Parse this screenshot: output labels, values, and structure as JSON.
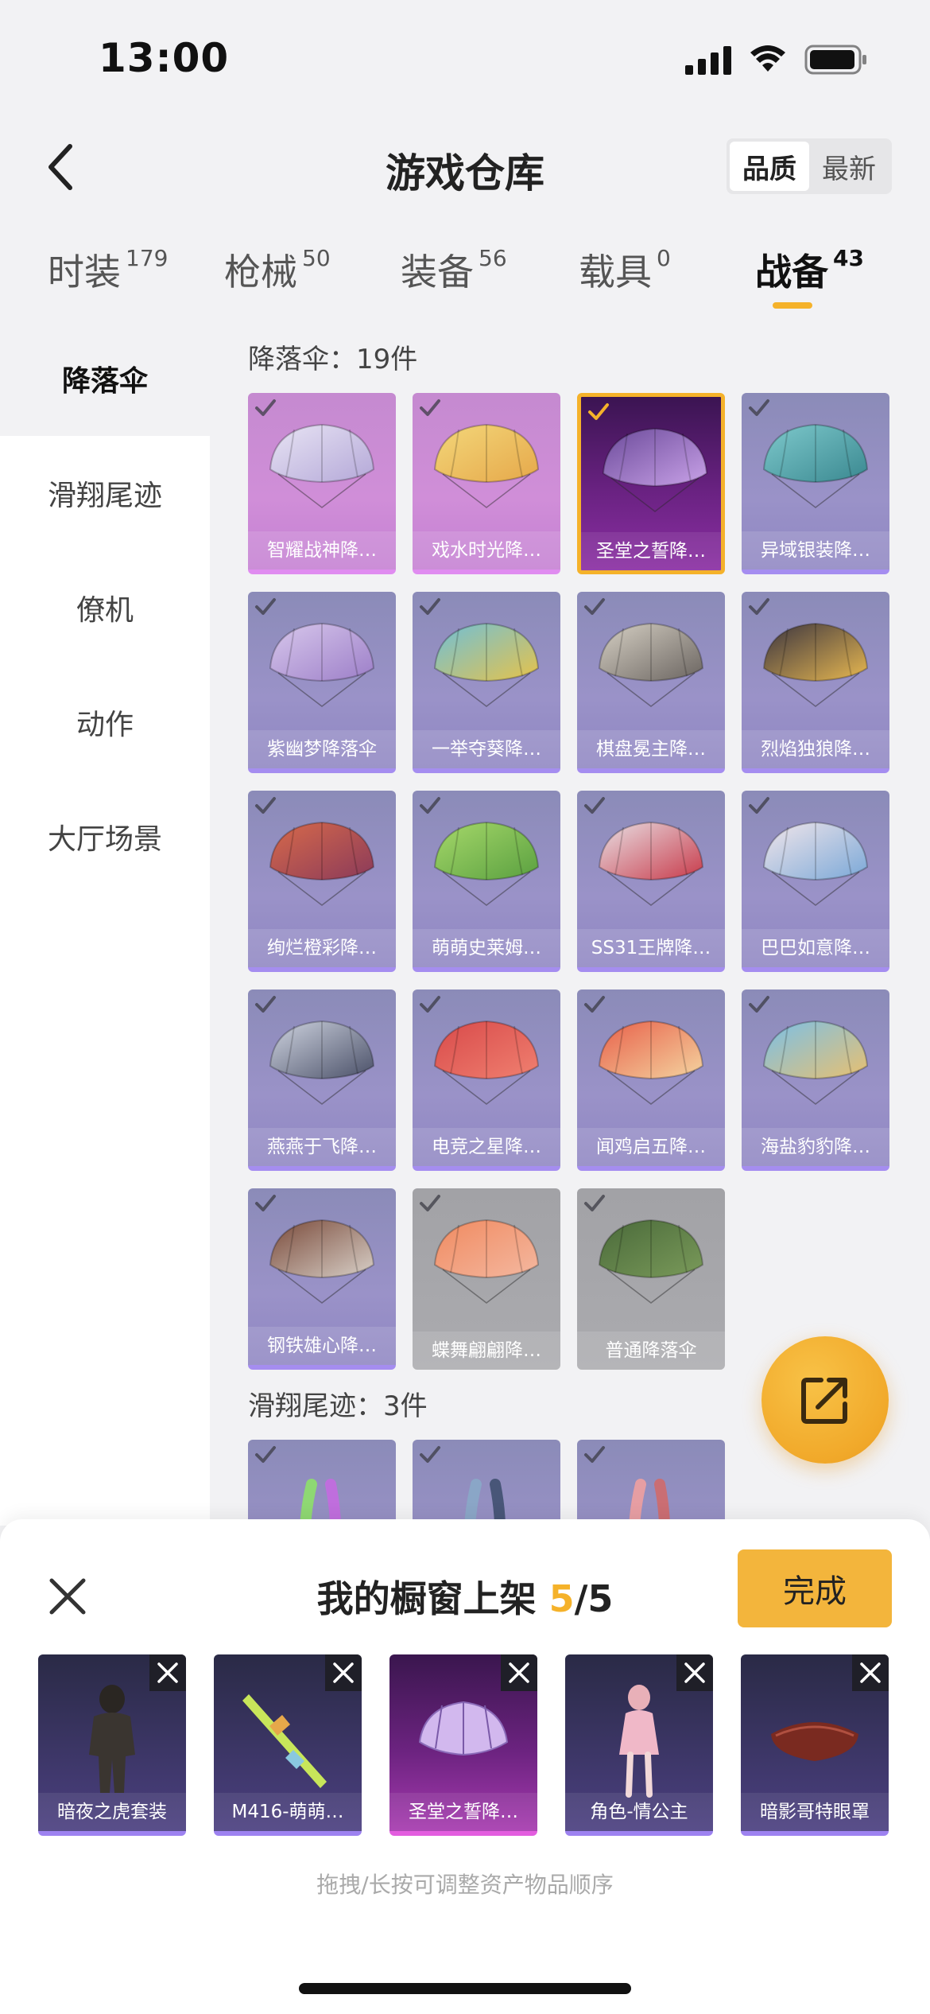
{
  "status_bar": {
    "time": "13:00"
  },
  "nav": {
    "title": "游戏仓库",
    "sort_options": [
      "品质",
      "最新"
    ],
    "active_sort": "品质"
  },
  "category_tabs": [
    {
      "label": "时装",
      "count": "179"
    },
    {
      "label": "枪械",
      "count": "50"
    },
    {
      "label": "装备",
      "count": "56"
    },
    {
      "label": "载具",
      "count": "0"
    },
    {
      "label": "战备",
      "count": "43",
      "active": true
    }
  ],
  "sidebar": {
    "items": [
      {
        "label": "降落伞",
        "active": true
      },
      {
        "label": "滑翔尾迹"
      },
      {
        "label": "僚机"
      },
      {
        "label": "动作"
      },
      {
        "label": "大厅场景"
      }
    ]
  },
  "sections": [
    {
      "title": "降落伞：19件",
      "items": [
        {
          "name": "智耀战神降…",
          "quality": "pink"
        },
        {
          "name": "戏水时光降…",
          "quality": "pink"
        },
        {
          "name": "圣堂之誓降…",
          "quality": "selected"
        },
        {
          "name": "异域银装降…",
          "quality": "purple"
        },
        {
          "name": "紫幽梦降落伞",
          "quality": "purple"
        },
        {
          "name": "一举夺葵降…",
          "quality": "purple"
        },
        {
          "name": "棋盘冕主降…",
          "quality": "purple"
        },
        {
          "name": "烈焰独狼降…",
          "quality": "purple"
        },
        {
          "name": "绚烂橙彩降…",
          "quality": "purple"
        },
        {
          "name": "萌萌史莱姆…",
          "quality": "purple"
        },
        {
          "name": "SS31王牌降…",
          "quality": "purple"
        },
        {
          "name": "巴巴如意降…",
          "quality": "purple"
        },
        {
          "name": "燕燕于飞降…",
          "quality": "purple"
        },
        {
          "name": "电竞之星降…",
          "quality": "purple"
        },
        {
          "name": "闻鸡启五降…",
          "quality": "purple"
        },
        {
          "name": "海盐豹豹降…",
          "quality": "purple"
        },
        {
          "name": "钢铁雄心降…",
          "quality": "purple"
        },
        {
          "name": "蝶舞翩翩降…",
          "quality": "grey"
        },
        {
          "name": "普通降落伞",
          "quality": "grey"
        }
      ]
    },
    {
      "title": "滑翔尾迹：3件",
      "items": [
        {
          "name": "",
          "quality": "purple"
        },
        {
          "name": "",
          "quality": "purple"
        },
        {
          "name": "",
          "quality": "purple"
        }
      ]
    }
  ],
  "shelf": {
    "title_prefix": "我的橱窗上架",
    "current": "5",
    "total": "/5",
    "done_label": "完成",
    "hint": "拖拽/长按可调整资产物品顺序",
    "items": [
      {
        "name": "暗夜之虎套装",
        "style": "purple"
      },
      {
        "name": "M416-萌萌…",
        "style": "purple"
      },
      {
        "name": "圣堂之誓降…",
        "style": "pink"
      },
      {
        "name": "角色-情公主",
        "style": "purple"
      },
      {
        "name": "暗影哥特眼罩",
        "style": "purple"
      }
    ]
  },
  "colors": {
    "accent": "#f5b22a",
    "background": "#f2f2f4",
    "purple_quality": "#9a92c8",
    "pink_quality": "#d08ed8"
  },
  "icons": {
    "back": "chevron-left-icon",
    "share": "share-out-icon",
    "close": "close-icon",
    "check": "check-icon"
  }
}
